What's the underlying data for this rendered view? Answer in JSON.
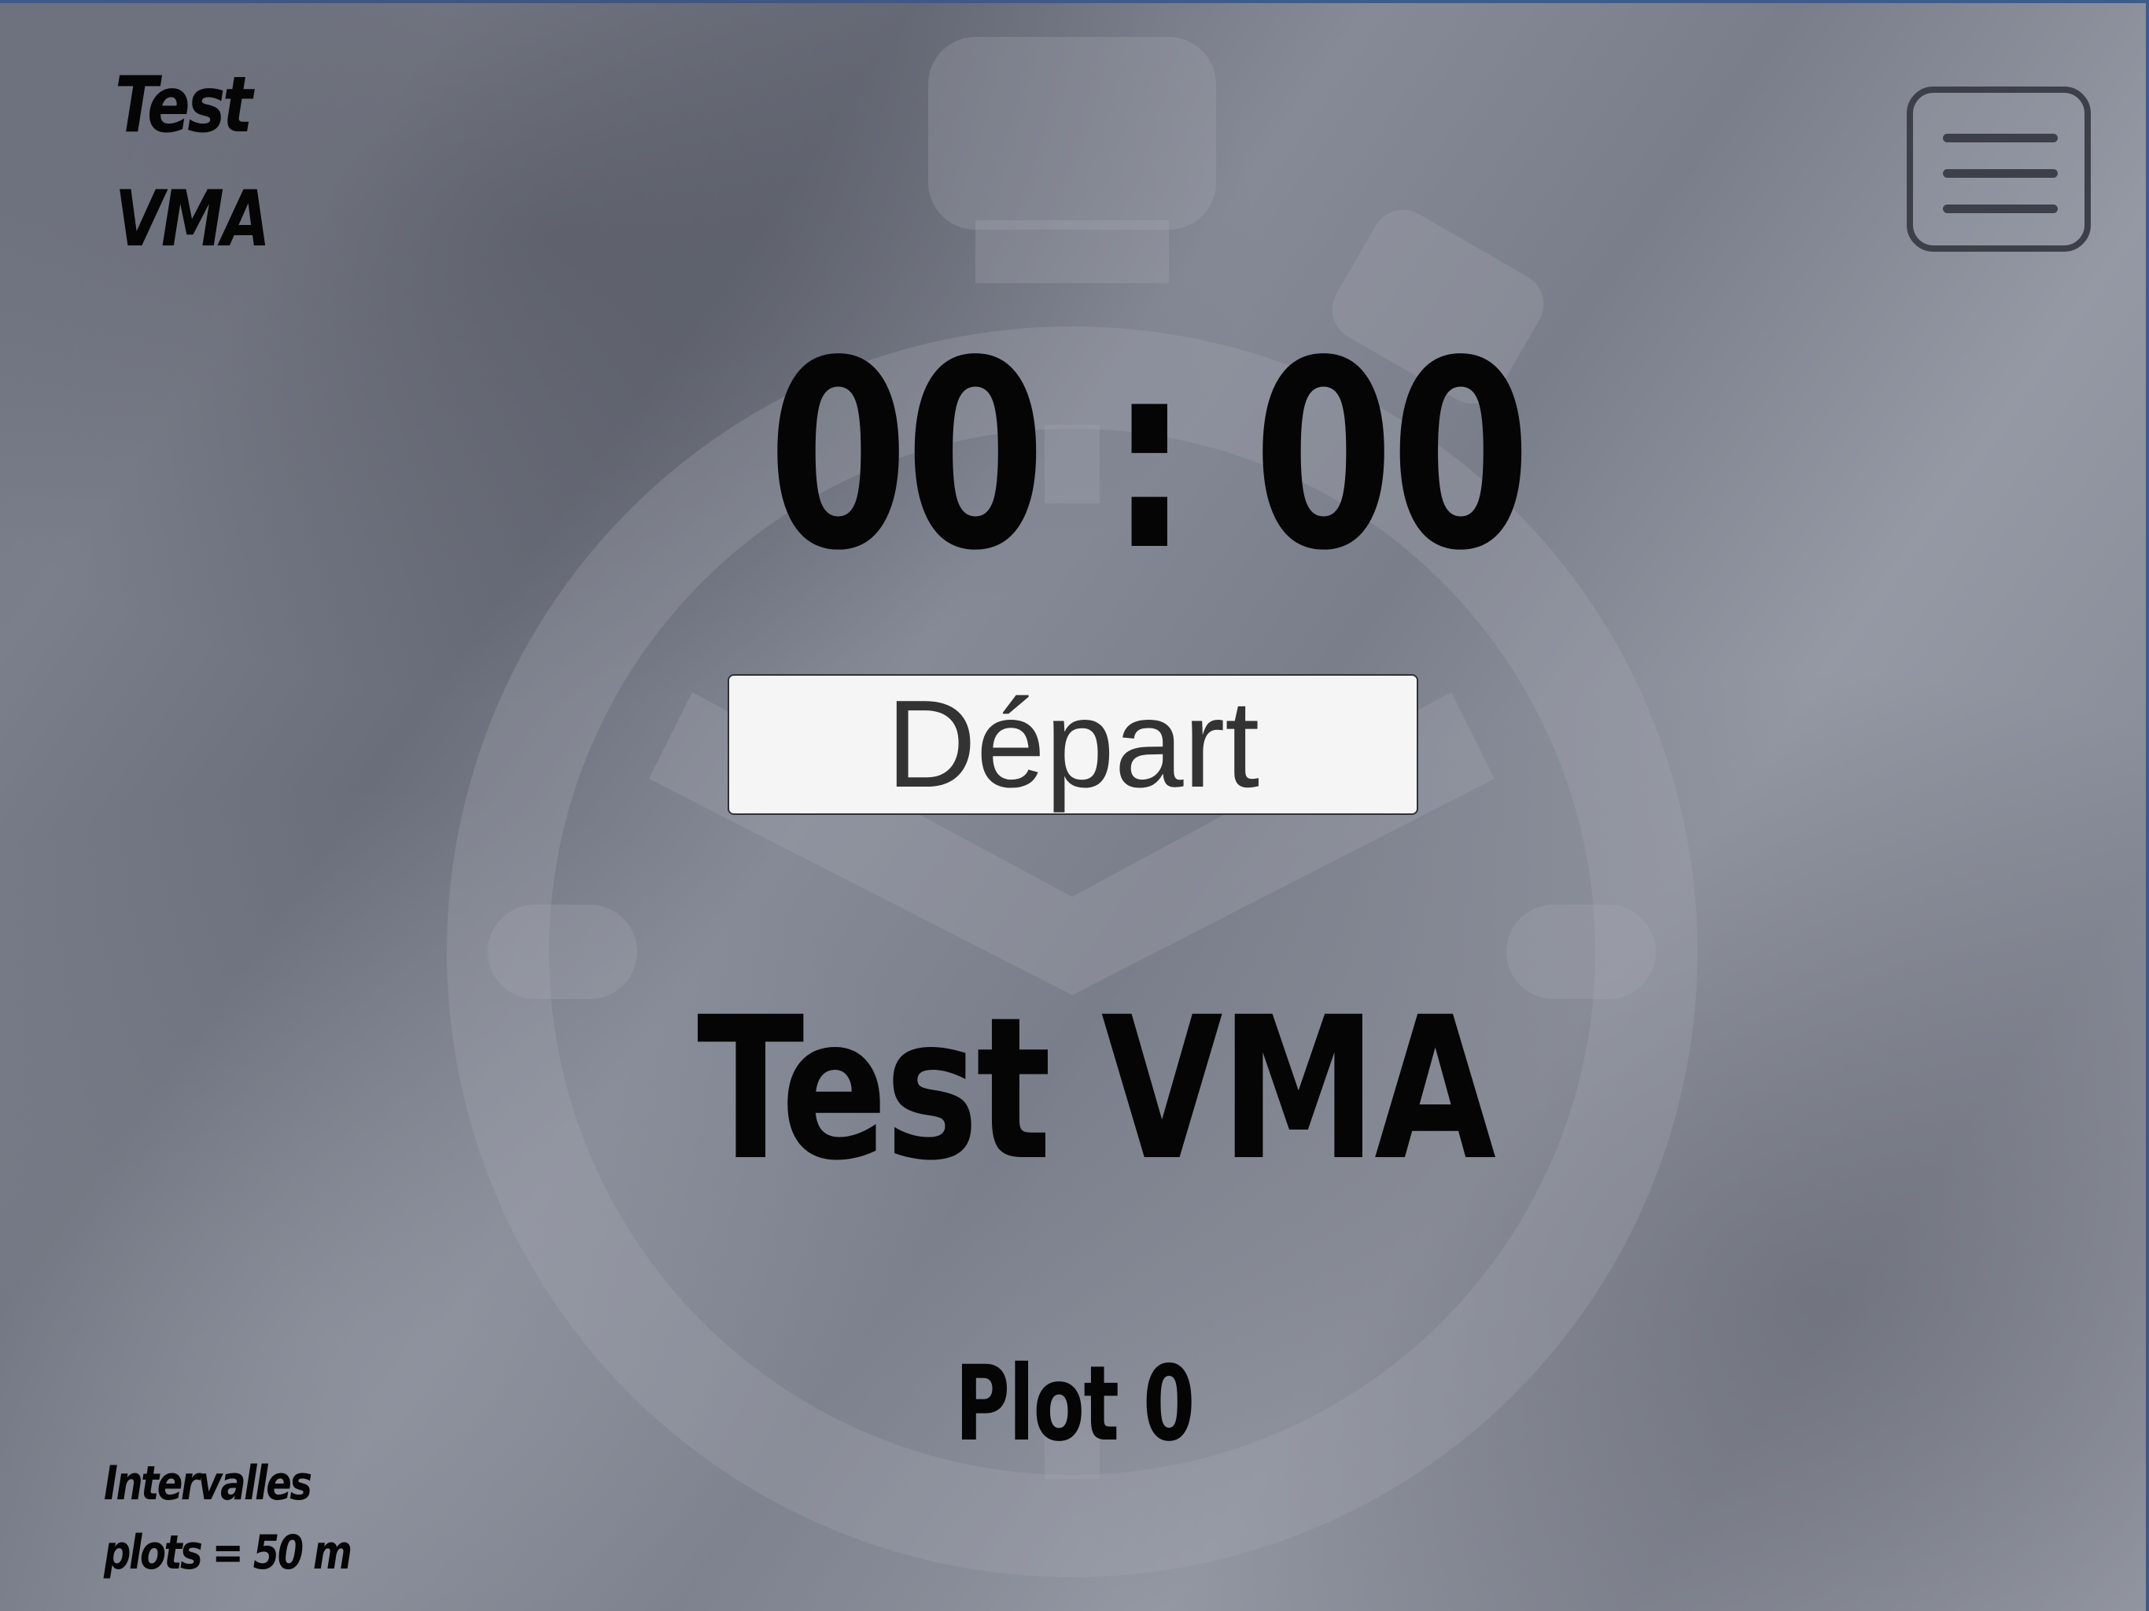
{
  "app": {
    "brand_line1": "Test",
    "brand_line2": "VMA"
  },
  "menu": {
    "icon": "hamburger-menu-icon"
  },
  "timer": {
    "display": "00 : 00"
  },
  "controls": {
    "start_label": "Départ"
  },
  "main": {
    "title": "Test VMA",
    "plot_status": "Plot 0"
  },
  "footer": {
    "interval_line1": "Intervalles",
    "interval_line2": "plots = 50 m"
  },
  "background": {
    "icon": "stopwatch-icon"
  },
  "colors": {
    "text": "#050505",
    "button_bg": "#f5f5f5",
    "menu_border": "#3d4048"
  }
}
